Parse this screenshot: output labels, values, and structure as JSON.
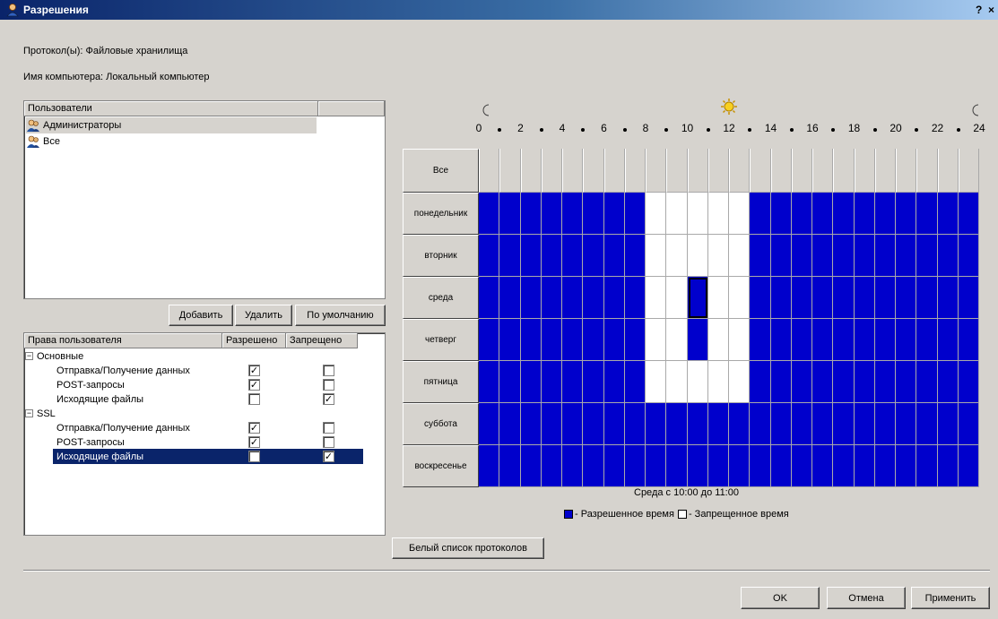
{
  "window": {
    "title": "Разрешения",
    "help_label": "?",
    "close_label": "×"
  },
  "info": {
    "protocols": "Протокол(ы): Файловые хранилища",
    "computer": "Имя компьютера: Локальный компьютер"
  },
  "users": {
    "header": "Пользователи",
    "items": [
      {
        "label": "Администраторы",
        "icon": "admin-users-icon",
        "selected": true
      },
      {
        "label": "Все",
        "icon": "everyone-users-icon",
        "selected": false
      }
    ]
  },
  "user_buttons": {
    "add": "Добавить",
    "remove": "Удалить",
    "default": "По умолчанию"
  },
  "rights": {
    "headers": {
      "name": "Права пользователя",
      "allowed": "Разрешено",
      "denied": "Запрещено"
    },
    "groups": [
      {
        "name": "Основные",
        "items": [
          {
            "label": "Отправка/Получение данных",
            "allowed": true,
            "denied": false
          },
          {
            "label": "POST-запросы",
            "allowed": true,
            "denied": false
          },
          {
            "label": "Исходящие файлы",
            "allowed": false,
            "denied": true
          }
        ]
      },
      {
        "name": "SSL",
        "items": [
          {
            "label": "Отправка/Получение данных",
            "allowed": true,
            "denied": false
          },
          {
            "label": "POST-запросы",
            "allowed": true,
            "denied": false
          },
          {
            "label": "Исходящие файлы",
            "allowed": false,
            "denied": true,
            "selected": true
          }
        ]
      }
    ]
  },
  "schedule": {
    "all_label": "Все",
    "hour_labels": [
      "0",
      "2",
      "4",
      "6",
      "8",
      "10",
      "12",
      "14",
      "16",
      "18",
      "20",
      "22",
      "24"
    ],
    "days": [
      {
        "label": "понедельник",
        "allowed": [
          1,
          1,
          1,
          1,
          1,
          1,
          1,
          1,
          0,
          0,
          0,
          0,
          0,
          1,
          1,
          1,
          1,
          1,
          1,
          1,
          1,
          1,
          1,
          1
        ]
      },
      {
        "label": "вторник",
        "allowed": [
          1,
          1,
          1,
          1,
          1,
          1,
          1,
          1,
          0,
          0,
          0,
          0,
          0,
          1,
          1,
          1,
          1,
          1,
          1,
          1,
          1,
          1,
          1,
          1
        ]
      },
      {
        "label": "среда",
        "allowed": [
          1,
          1,
          1,
          1,
          1,
          1,
          1,
          1,
          0,
          0,
          1,
          0,
          0,
          1,
          1,
          1,
          1,
          1,
          1,
          1,
          1,
          1,
          1,
          1
        ]
      },
      {
        "label": "четверг",
        "allowed": [
          1,
          1,
          1,
          1,
          1,
          1,
          1,
          1,
          0,
          0,
          1,
          0,
          0,
          1,
          1,
          1,
          1,
          1,
          1,
          1,
          1,
          1,
          1,
          1
        ]
      },
      {
        "label": "пятница",
        "allowed": [
          1,
          1,
          1,
          1,
          1,
          1,
          1,
          1,
          0,
          0,
          0,
          0,
          0,
          1,
          1,
          1,
          1,
          1,
          1,
          1,
          1,
          1,
          1,
          1
        ]
      },
      {
        "label": "суббота",
        "allowed": [
          1,
          1,
          1,
          1,
          1,
          1,
          1,
          1,
          1,
          1,
          1,
          1,
          1,
          1,
          1,
          1,
          1,
          1,
          1,
          1,
          1,
          1,
          1,
          1
        ]
      },
      {
        "label": "воскресенье",
        "allowed": [
          1,
          1,
          1,
          1,
          1,
          1,
          1,
          1,
          1,
          1,
          1,
          1,
          1,
          1,
          1,
          1,
          1,
          1,
          1,
          1,
          1,
          1,
          1,
          1
        ]
      }
    ],
    "focus": {
      "day": "среда",
      "hour": 10
    },
    "status_text": "Среда с 10:00 до 11:00",
    "legend_allowed": "- Разрешенное время",
    "legend_denied": "- Запрещенное время",
    "allowed_color": "#0000cc",
    "denied_color": "#ffffff"
  },
  "whitelist_button": "Белый список протоколов",
  "footer": {
    "ok": "OK",
    "cancel": "Отмена",
    "apply": "Применить"
  }
}
